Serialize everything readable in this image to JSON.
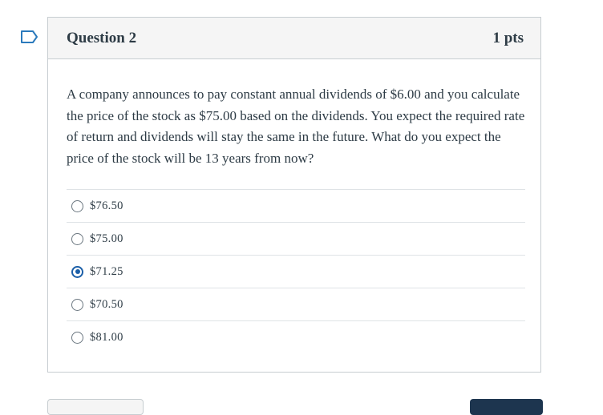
{
  "question": {
    "title": "Question 2",
    "points": "1 pts",
    "text": "A company announces to pay constant annual dividends of $6.00 and you calculate the price of the stock as $75.00 based on the dividends. You expect the required rate of return and dividends will stay the same in the future. What do you expect the price of the stock will be 13 years from now?",
    "flag_icon": "bookmark-flag-icon",
    "answers": [
      {
        "label": "$76.50",
        "selected": false
      },
      {
        "label": "$75.00",
        "selected": false
      },
      {
        "label": "$71.25",
        "selected": true
      },
      {
        "label": "$70.50",
        "selected": false
      },
      {
        "label": "$81.00",
        "selected": false
      }
    ]
  },
  "colors": {
    "accent": "#1b5fa8",
    "flag": "#2b7abc",
    "header_bg": "#f5f5f5",
    "border": "#c7cdd1",
    "next_button": "#1d354f"
  }
}
